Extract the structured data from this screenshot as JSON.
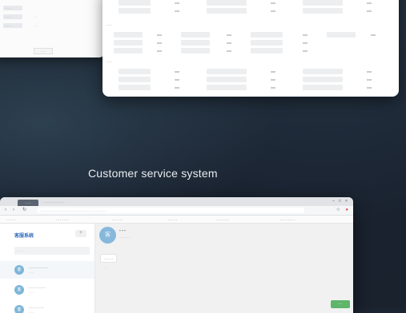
{
  "heading": "Customer service system",
  "left_panel": {
    "fields": [
      "- - - -",
      "- - - -",
      "- - - -"
    ],
    "values": [
      "- -",
      "- -"
    ],
    "button": "- - -"
  },
  "top_panel": {
    "section_labels": [
      "- - -",
      "- - -"
    ]
  },
  "app": {
    "tabs": {
      "active": "- - -",
      "tab2": "- - - - - - - - - - -"
    },
    "window_controls": {
      "minimize": "–",
      "maximize": "□",
      "close": "×"
    },
    "url": "- - - - - - - - - - - - - - - - - - - - - - - - - - - - - - - - - -",
    "bookmarks": [
      "- - - - -",
      "- - - - - - -",
      "- - - - - -",
      "- - - - -",
      "- - - - - - -",
      "- - - - - - - -"
    ],
    "sidebar": {
      "title": "客服系统",
      "add_label": "+",
      "search_placeholder": "- - - -",
      "contacts": [
        {
          "avatar": "客",
          "name": "- - - - - - - - - -",
          "sub": "- - -"
        },
        {
          "avatar": "客",
          "name": "- - - - - - - - -",
          "sub": "- - -"
        },
        {
          "avatar": "客",
          "name": "- - - - - - - -",
          "sub": "- - -"
        }
      ]
    },
    "chat": {
      "avatar": "客",
      "name": "- - -",
      "sub": "- - - - - -",
      "message": "- - - - -",
      "time": "- -",
      "send_label": "- -"
    }
  },
  "colors": {
    "background": "#1b2431",
    "accent_blue": "#2f6bbd",
    "send_green": "#5fb56a"
  }
}
